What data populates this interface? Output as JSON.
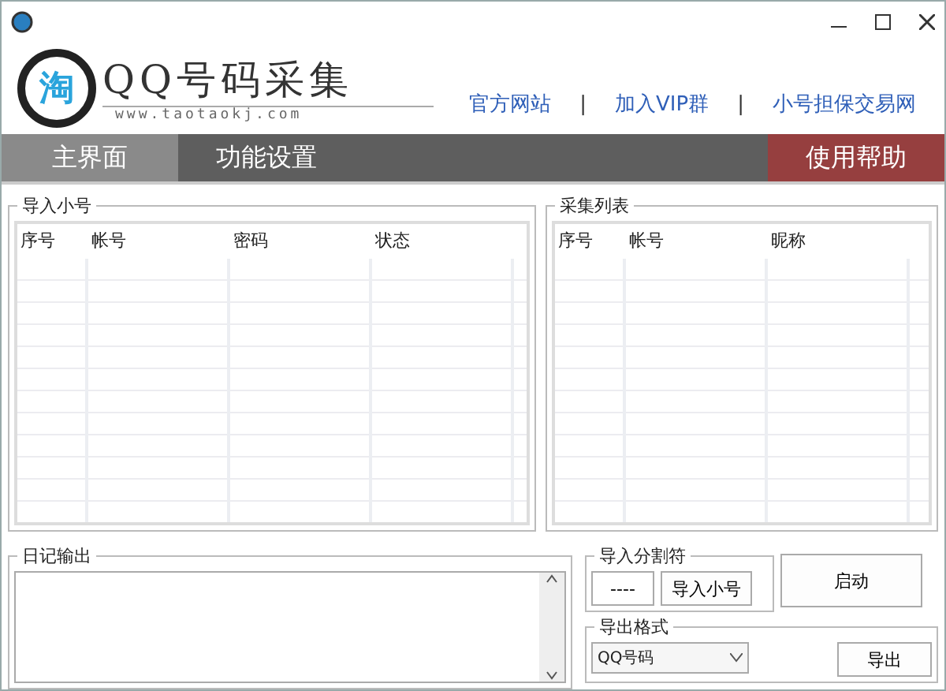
{
  "logo": {
    "mark": "淘",
    "title": "QQ号码采集",
    "url": "www.taotaokj.com"
  },
  "links": [
    {
      "label": "官方网站"
    },
    {
      "label": "加入VIP群"
    },
    {
      "label": "小号担保交易网"
    }
  ],
  "link_separator": "|",
  "nav": [
    {
      "label": "主界面",
      "selected": true,
      "kind": "tab"
    },
    {
      "label": "功能设置",
      "selected": false,
      "kind": "tab"
    },
    {
      "label": "使用帮助",
      "selected": false,
      "kind": "help"
    }
  ],
  "import_group": {
    "title": "导入小号",
    "columns": [
      "序号",
      "帐号",
      "密码",
      "状态"
    ]
  },
  "collect_group": {
    "title": "采集列表",
    "columns": [
      "序号",
      "帐号",
      "昵称"
    ]
  },
  "log_group": {
    "title": "日记输出"
  },
  "separator_group": {
    "title": "导入分割符",
    "value": "----",
    "button": "导入小号"
  },
  "start_button": "启动",
  "export_group": {
    "title": "导出格式",
    "format": "QQ号码",
    "button": "导出"
  }
}
